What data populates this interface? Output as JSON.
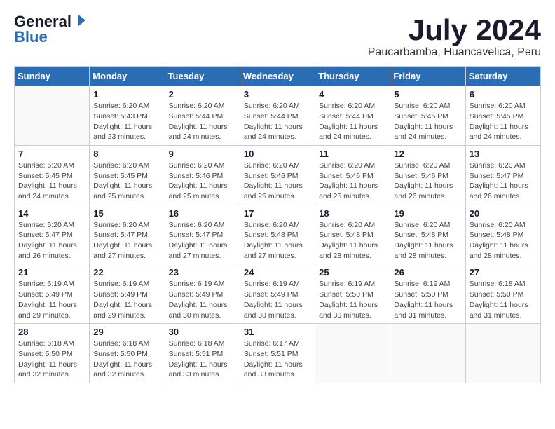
{
  "header": {
    "logo_general": "General",
    "logo_blue": "Blue",
    "month_title": "July 2024",
    "subtitle": "Paucarbamba, Huancavelica, Peru"
  },
  "weekdays": [
    "Sunday",
    "Monday",
    "Tuesday",
    "Wednesday",
    "Thursday",
    "Friday",
    "Saturday"
  ],
  "weeks": [
    [
      {
        "day": "",
        "info": ""
      },
      {
        "day": "1",
        "info": "Sunrise: 6:20 AM\nSunset: 5:43 PM\nDaylight: 11 hours\nand 23 minutes."
      },
      {
        "day": "2",
        "info": "Sunrise: 6:20 AM\nSunset: 5:44 PM\nDaylight: 11 hours\nand 24 minutes."
      },
      {
        "day": "3",
        "info": "Sunrise: 6:20 AM\nSunset: 5:44 PM\nDaylight: 11 hours\nand 24 minutes."
      },
      {
        "day": "4",
        "info": "Sunrise: 6:20 AM\nSunset: 5:44 PM\nDaylight: 11 hours\nand 24 minutes."
      },
      {
        "day": "5",
        "info": "Sunrise: 6:20 AM\nSunset: 5:45 PM\nDaylight: 11 hours\nand 24 minutes."
      },
      {
        "day": "6",
        "info": "Sunrise: 6:20 AM\nSunset: 5:45 PM\nDaylight: 11 hours\nand 24 minutes."
      }
    ],
    [
      {
        "day": "7",
        "info": "Sunrise: 6:20 AM\nSunset: 5:45 PM\nDaylight: 11 hours\nand 24 minutes."
      },
      {
        "day": "8",
        "info": "Sunrise: 6:20 AM\nSunset: 5:45 PM\nDaylight: 11 hours\nand 25 minutes."
      },
      {
        "day": "9",
        "info": "Sunrise: 6:20 AM\nSunset: 5:46 PM\nDaylight: 11 hours\nand 25 minutes."
      },
      {
        "day": "10",
        "info": "Sunrise: 6:20 AM\nSunset: 5:46 PM\nDaylight: 11 hours\nand 25 minutes."
      },
      {
        "day": "11",
        "info": "Sunrise: 6:20 AM\nSunset: 5:46 PM\nDaylight: 11 hours\nand 25 minutes."
      },
      {
        "day": "12",
        "info": "Sunrise: 6:20 AM\nSunset: 5:46 PM\nDaylight: 11 hours\nand 26 minutes."
      },
      {
        "day": "13",
        "info": "Sunrise: 6:20 AM\nSunset: 5:47 PM\nDaylight: 11 hours\nand 26 minutes."
      }
    ],
    [
      {
        "day": "14",
        "info": "Sunrise: 6:20 AM\nSunset: 5:47 PM\nDaylight: 11 hours\nand 26 minutes."
      },
      {
        "day": "15",
        "info": "Sunrise: 6:20 AM\nSunset: 5:47 PM\nDaylight: 11 hours\nand 27 minutes."
      },
      {
        "day": "16",
        "info": "Sunrise: 6:20 AM\nSunset: 5:47 PM\nDaylight: 11 hours\nand 27 minutes."
      },
      {
        "day": "17",
        "info": "Sunrise: 6:20 AM\nSunset: 5:48 PM\nDaylight: 11 hours\nand 27 minutes."
      },
      {
        "day": "18",
        "info": "Sunrise: 6:20 AM\nSunset: 5:48 PM\nDaylight: 11 hours\nand 28 minutes."
      },
      {
        "day": "19",
        "info": "Sunrise: 6:20 AM\nSunset: 5:48 PM\nDaylight: 11 hours\nand 28 minutes."
      },
      {
        "day": "20",
        "info": "Sunrise: 6:20 AM\nSunset: 5:48 PM\nDaylight: 11 hours\nand 28 minutes."
      }
    ],
    [
      {
        "day": "21",
        "info": "Sunrise: 6:19 AM\nSunset: 5:49 PM\nDaylight: 11 hours\nand 29 minutes."
      },
      {
        "day": "22",
        "info": "Sunrise: 6:19 AM\nSunset: 5:49 PM\nDaylight: 11 hours\nand 29 minutes."
      },
      {
        "day": "23",
        "info": "Sunrise: 6:19 AM\nSunset: 5:49 PM\nDaylight: 11 hours\nand 30 minutes."
      },
      {
        "day": "24",
        "info": "Sunrise: 6:19 AM\nSunset: 5:49 PM\nDaylight: 11 hours\nand 30 minutes."
      },
      {
        "day": "25",
        "info": "Sunrise: 6:19 AM\nSunset: 5:50 PM\nDaylight: 11 hours\nand 30 minutes."
      },
      {
        "day": "26",
        "info": "Sunrise: 6:19 AM\nSunset: 5:50 PM\nDaylight: 11 hours\nand 31 minutes."
      },
      {
        "day": "27",
        "info": "Sunrise: 6:18 AM\nSunset: 5:50 PM\nDaylight: 11 hours\nand 31 minutes."
      }
    ],
    [
      {
        "day": "28",
        "info": "Sunrise: 6:18 AM\nSunset: 5:50 PM\nDaylight: 11 hours\nand 32 minutes."
      },
      {
        "day": "29",
        "info": "Sunrise: 6:18 AM\nSunset: 5:50 PM\nDaylight: 11 hours\nand 32 minutes."
      },
      {
        "day": "30",
        "info": "Sunrise: 6:18 AM\nSunset: 5:51 PM\nDaylight: 11 hours\nand 33 minutes."
      },
      {
        "day": "31",
        "info": "Sunrise: 6:17 AM\nSunset: 5:51 PM\nDaylight: 11 hours\nand 33 minutes."
      },
      {
        "day": "",
        "info": ""
      },
      {
        "day": "",
        "info": ""
      },
      {
        "day": "",
        "info": ""
      }
    ]
  ]
}
